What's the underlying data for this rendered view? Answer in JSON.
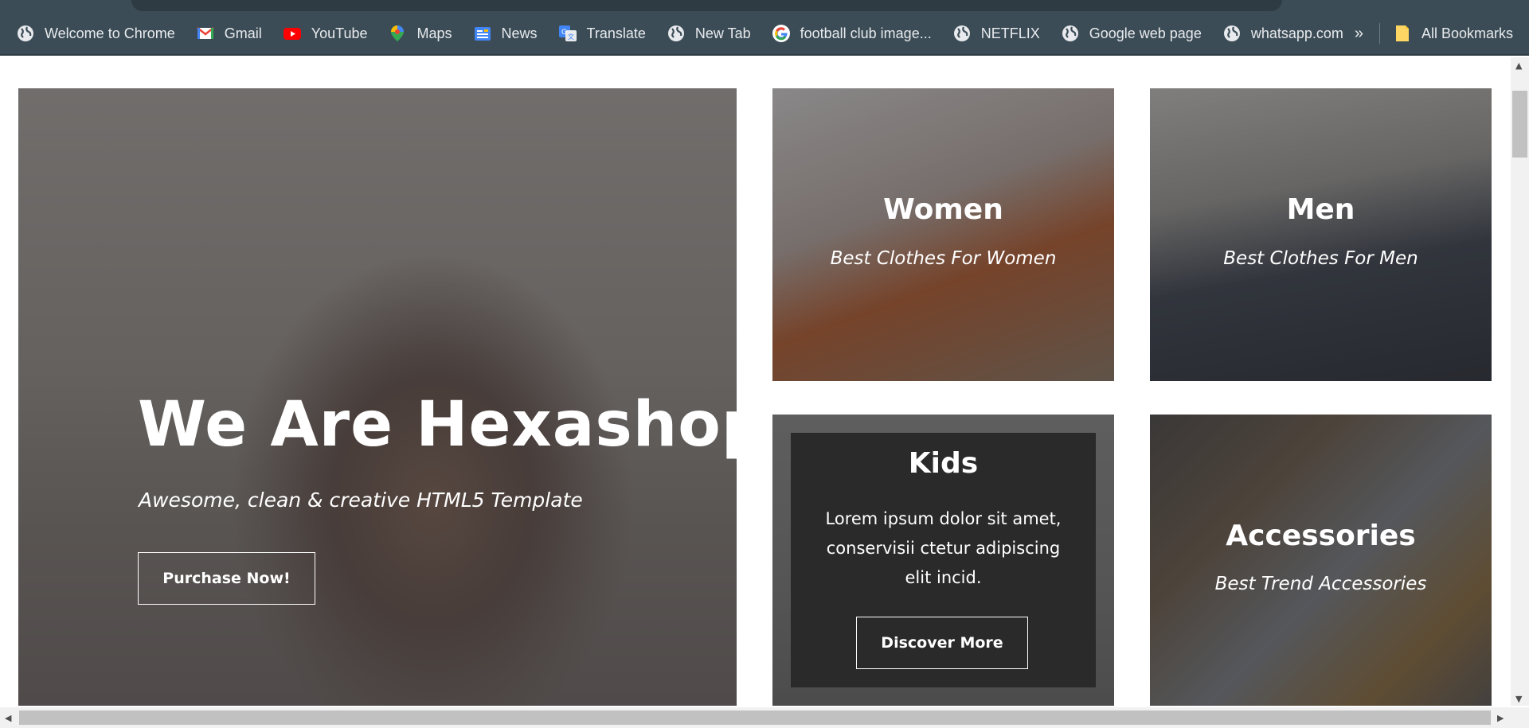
{
  "bookmarks": {
    "items": [
      {
        "label": "Welcome to Chrome",
        "icon": "globe-icon"
      },
      {
        "label": "Gmail",
        "icon": "gmail-icon"
      },
      {
        "label": "YouTube",
        "icon": "youtube-icon"
      },
      {
        "label": "Maps",
        "icon": "maps-icon"
      },
      {
        "label": "News",
        "icon": "news-icon"
      },
      {
        "label": "Translate",
        "icon": "translate-icon"
      },
      {
        "label": "New Tab",
        "icon": "globe-icon"
      },
      {
        "label": "football club image...",
        "icon": "google-icon"
      },
      {
        "label": "NETFLIX",
        "icon": "globe-icon"
      },
      {
        "label": "Google web page",
        "icon": "globe-icon"
      },
      {
        "label": "whatsapp.com",
        "icon": "globe-icon"
      }
    ],
    "overflow": "»",
    "all_bookmarks": "All Bookmarks"
  },
  "hero": {
    "title": "We Are Hexashop",
    "subtitle": "Awesome, clean & creative HTML5 Template",
    "button": "Purchase Now!"
  },
  "categories": {
    "women": {
      "title": "Women",
      "subtitle": "Best Clothes For Women"
    },
    "men": {
      "title": "Men",
      "subtitle": "Best Clothes For Men"
    },
    "kids": {
      "title": "Kids",
      "description": "Lorem ipsum dolor sit amet, conservisii ctetur adipiscing elit incid.",
      "button": "Discover More"
    },
    "accessories": {
      "title": "Accessories",
      "subtitle": "Best Trend Accessories"
    }
  },
  "colors": {
    "toolbar": "#3b4c56",
    "bookmark_text": "#e8eaed",
    "overlay_text": "#ffffff",
    "kids_panel": "#2a2a2a"
  }
}
